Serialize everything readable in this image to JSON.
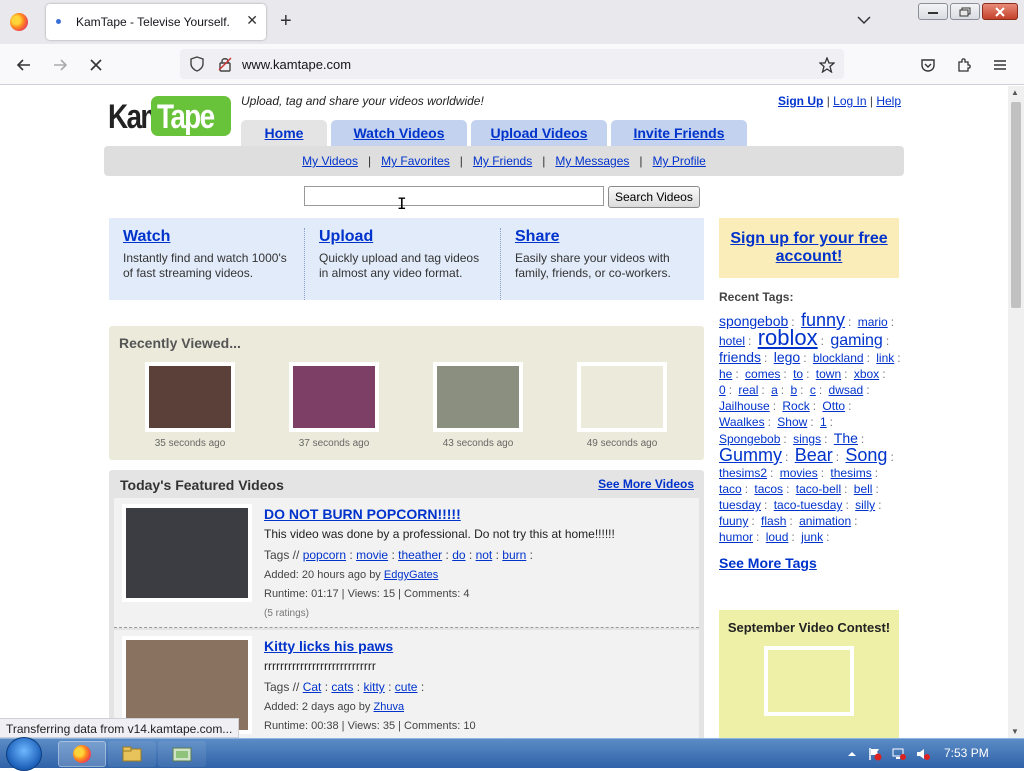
{
  "browser": {
    "tab_title": "KamTape - Televise Yourself.",
    "url_domain": "www.kamtape.com",
    "status_text": "Transferring data from v14.kamtape.com..."
  },
  "site": {
    "logo": "KamTape",
    "logo_part1": "Kam",
    "logo_part2": "Tape",
    "tagline": "Upload, tag and share your videos worldwide!",
    "top_links": [
      "Sign Up",
      "Log In",
      "Help"
    ],
    "main_tabs": [
      "Home",
      "Watch Videos",
      "Upload Videos",
      "Invite Friends"
    ],
    "sub_nav": [
      "My Videos",
      "My Favorites",
      "My Friends",
      "My Messages",
      "My Profile"
    ],
    "search": {
      "value": "",
      "button": "Search Videos"
    }
  },
  "promo": [
    {
      "title": "Watch",
      "desc": "Instantly find and watch 1000's of fast streaming videos."
    },
    {
      "title": "Upload",
      "desc": "Quickly upload and tag videos in almost any video format."
    },
    {
      "title": "Share",
      "desc": "Easily share your videos with family, friends, or co-workers."
    }
  ],
  "signup_box": "Sign up for your free account!",
  "recently_viewed": {
    "title": "Recently Viewed...",
    "items": [
      {
        "ago": "35 seconds ago",
        "color": "#5a4038"
      },
      {
        "ago": "37 seconds ago",
        "color": "#7d3f66"
      },
      {
        "ago": "43 seconds ago",
        "color": "#8a8f80"
      },
      {
        "ago": "49 seconds ago",
        "color": "#ecebdb"
      }
    ]
  },
  "featured": {
    "title": "Today's Featured Videos",
    "see_more": "See More Videos",
    "videos": [
      {
        "title": "DO NOT BURN POPCORN!!!!!",
        "desc": "This video was done by a professional. Do not try this at home!!!!!!",
        "tags_label": "Tags //",
        "tags": [
          "popcorn",
          "movie",
          "theather",
          "do",
          "not",
          "burn"
        ],
        "added_prefix": "Added: 20 hours ago by",
        "user": "EdgyGates",
        "stats": "Runtime: 01:17 | Views: 15 | Comments: 4",
        "ratings": "(5 ratings)",
        "color": "#3b3d42"
      },
      {
        "title": "Kitty licks his paws",
        "desc": "rrrrrrrrrrrrrrrrrrrrrrrrrrrr",
        "tags_label": "Tags //",
        "tags": [
          "Cat",
          "cats",
          "kitty",
          "cute"
        ],
        "added_prefix": "Added: 2 days ago by",
        "user": "Zhuva",
        "stats": "Runtime: 00:38 | Views: 35 | Comments: 10",
        "ratings": "",
        "color": "#8a7260"
      }
    ]
  },
  "recent_tags": {
    "title": "Recent Tags:",
    "tags": [
      {
        "t": "spongebob",
        "s": 14
      },
      {
        "t": "funny",
        "s": 18
      },
      {
        "t": "mario",
        "s": 12
      },
      {
        "t": "hotel",
        "s": 12
      },
      {
        "t": "roblox",
        "s": 22
      },
      {
        "t": "gaming",
        "s": 16
      },
      {
        "t": "friends",
        "s": 14
      },
      {
        "t": "lego",
        "s": 14
      },
      {
        "t": "blockland",
        "s": 12
      },
      {
        "t": "link",
        "s": 12
      },
      {
        "t": "he",
        "s": 12
      },
      {
        "t": "comes",
        "s": 12
      },
      {
        "t": "to",
        "s": 12
      },
      {
        "t": "town",
        "s": 12
      },
      {
        "t": "xbox",
        "s": 12
      },
      {
        "t": "0",
        "s": 12
      },
      {
        "t": "real",
        "s": 12
      },
      {
        "t": "a",
        "s": 12
      },
      {
        "t": "b",
        "s": 12
      },
      {
        "t": "c",
        "s": 12
      },
      {
        "t": "dwsad",
        "s": 12
      },
      {
        "t": "Jailhouse",
        "s": 12
      },
      {
        "t": "Rock",
        "s": 12
      },
      {
        "t": "Otto",
        "s": 12
      },
      {
        "t": "Waalkes",
        "s": 12
      },
      {
        "t": "Show",
        "s": 12
      },
      {
        "t": "1",
        "s": 12
      },
      {
        "t": "Spongebob",
        "s": 12
      },
      {
        "t": "sings",
        "s": 12
      },
      {
        "t": "The",
        "s": 14
      },
      {
        "t": "Gummy",
        "s": 18
      },
      {
        "t": "Bear",
        "s": 18
      },
      {
        "t": "Song",
        "s": 18
      },
      {
        "t": "thesims2",
        "s": 12
      },
      {
        "t": "movies",
        "s": 12
      },
      {
        "t": "thesims",
        "s": 12
      },
      {
        "t": "taco",
        "s": 12
      },
      {
        "t": "tacos",
        "s": 12
      },
      {
        "t": "taco-bell",
        "s": 12
      },
      {
        "t": "bell",
        "s": 12
      },
      {
        "t": "tuesday",
        "s": 12
      },
      {
        "t": "taco-tuesday",
        "s": 12
      },
      {
        "t": "silly",
        "s": 12
      },
      {
        "t": "fuuny",
        "s": 12
      },
      {
        "t": "flash",
        "s": 12
      },
      {
        "t": "animation",
        "s": 12
      },
      {
        "t": "humor",
        "s": 12
      },
      {
        "t": "loud",
        "s": 12
      },
      {
        "t": "junk",
        "s": 12
      }
    ],
    "see_more": "See More Tags"
  },
  "contest": {
    "title": "September Video Contest!"
  },
  "taskbar": {
    "clock": "7:53 PM"
  }
}
